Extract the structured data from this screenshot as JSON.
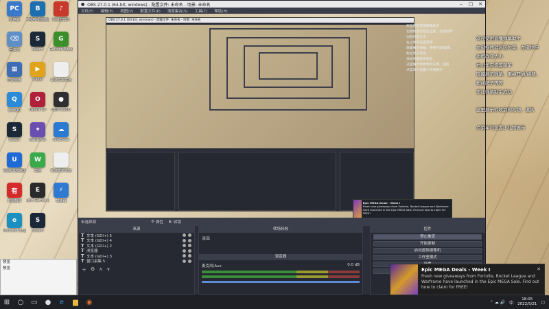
{
  "window": {
    "title": "OBS 27.0.1 (64-bit, windows) - 配置文件: 未命名 - 场景: 未命名",
    "menu": [
      "文件(F)",
      "编辑(E)",
      "视图(V)",
      "配置文件(P)",
      "场景集合(S)",
      "工具(T)",
      "帮助(H)"
    ]
  },
  "preview_notes": [
    "欢迎使用直播弹幕助手",
    "左键拖拽消息区位置、左键拉伸",
    "边框改变大小",
    "右上角有设置菜单",
    "隐藏展示弹幕、更换开通/续费、",
    "粉丝牌子等等",
    "添加弹幕助手成功",
    "这里展示你收到的礼物、道具",
    "点菜单可设置小礼物展示"
  ],
  "status": {
    "scene_label": "未选择源",
    "props": "属性",
    "filters": "滤镜"
  },
  "docks": {
    "sources_title": "来源",
    "sources": [
      "文本 (GDI+) 5",
      "文本 (GDI+) 4",
      "文本 (GDI+) 2",
      "浏览器",
      "文本 (GDI+) 3",
      "窗口采集 5"
    ],
    "transition_title": "转场特效",
    "transition_value": "淡出",
    "mixer_title": "混音器",
    "mixer_track": "麦克风/Aux",
    "mixer_db": "0.0 dB",
    "controls_title": "控件",
    "controls": [
      "停止推流",
      "开始录制",
      "启动虚拟摄像机",
      "工作室模式",
      "设置",
      "退出"
    ]
  },
  "side_notes": [
    "欢迎使用直播弹幕助手",
    "左键拖拽消息区位置、左键拉伸",
    "边框改变大小",
    "右上角有设置菜单",
    "隐藏展示弹幕、更换开通/续费、",
    "粉丝牌子等等",
    "添加弹幕助手成功",
    "",
    "这里展示你收到的礼物、道具",
    "",
    "点菜单可设置小礼物展示"
  ],
  "toast": {
    "title": "Epic MEGA Deals - Week I",
    "message": "Fresh new giveaways from Fortnite, Rocket League and Warframe have launched in the Epic MEGA Sale. Find out how to claim for FREE!"
  },
  "popup": {
    "items": [
      "预览",
      "预览"
    ]
  },
  "desktop_icons": [
    {
      "label": "此电脑",
      "color": "#3a78c9",
      "glyph": "PC"
    },
    {
      "label": "哔哩哔哩直播姬",
      "color": "#1e6fb0",
      "glyph": "B"
    },
    {
      "label": "网易云音乐",
      "color": "#c8392b",
      "glyph": "♪"
    },
    {
      "label": "回收站",
      "color": "#5e8fc7",
      "glyph": "⌫"
    },
    {
      "label": "Steam",
      "color": "#1b2838",
      "glyph": "S"
    },
    {
      "label": "Geforce Experience",
      "color": "#3b8f2a",
      "glyph": "G"
    },
    {
      "label": "控制面板",
      "color": "#3f6db3",
      "glyph": "▦"
    },
    {
      "label": "Player",
      "color": "#e0a41c",
      "glyph": "▶"
    },
    {
      "label": "新建文本文档",
      "color": "#eeeeee",
      "glyph": " "
    },
    {
      "label": "腾讯QQ",
      "color": "#2c8ad9",
      "glyph": "Q"
    },
    {
      "label": "Opera GX",
      "color": "#b0203a",
      "glyph": "O"
    },
    {
      "label": "OBS Studio",
      "color": "#302e31",
      "glyph": "●"
    },
    {
      "label": "Steam",
      "color": "#1b2838",
      "glyph": "S"
    },
    {
      "label": "BattleNet",
      "color": "#6a4fb0",
      "glyph": "✦"
    },
    {
      "label": "OneDrive",
      "color": "#2a7ad2",
      "glyph": "☁"
    },
    {
      "label": "网易UU加速器",
      "color": "#1f6ad6",
      "glyph": "U"
    },
    {
      "label": "微信",
      "color": "#39a94a",
      "glyph": "W"
    },
    {
      "label": "新建文本文档",
      "color": "#eeeeee",
      "glyph": " "
    },
    {
      "label": "有道翻译",
      "color": "#d42a2a",
      "glyph": "有"
    },
    {
      "label": "Epic Games Launcher",
      "color": "#2a2a2a",
      "glyph": "E"
    },
    {
      "label": "加速器",
      "color": "#2f7ad0",
      "glyph": "⚡"
    },
    {
      "label": "Microsoft Edge",
      "color": "#1a8fc0",
      "glyph": "e"
    },
    {
      "label": "Steam",
      "color": "#1b2838",
      "glyph": "S"
    }
  ],
  "taskbar": {
    "time": "18:05",
    "date": "2022/5/21"
  }
}
